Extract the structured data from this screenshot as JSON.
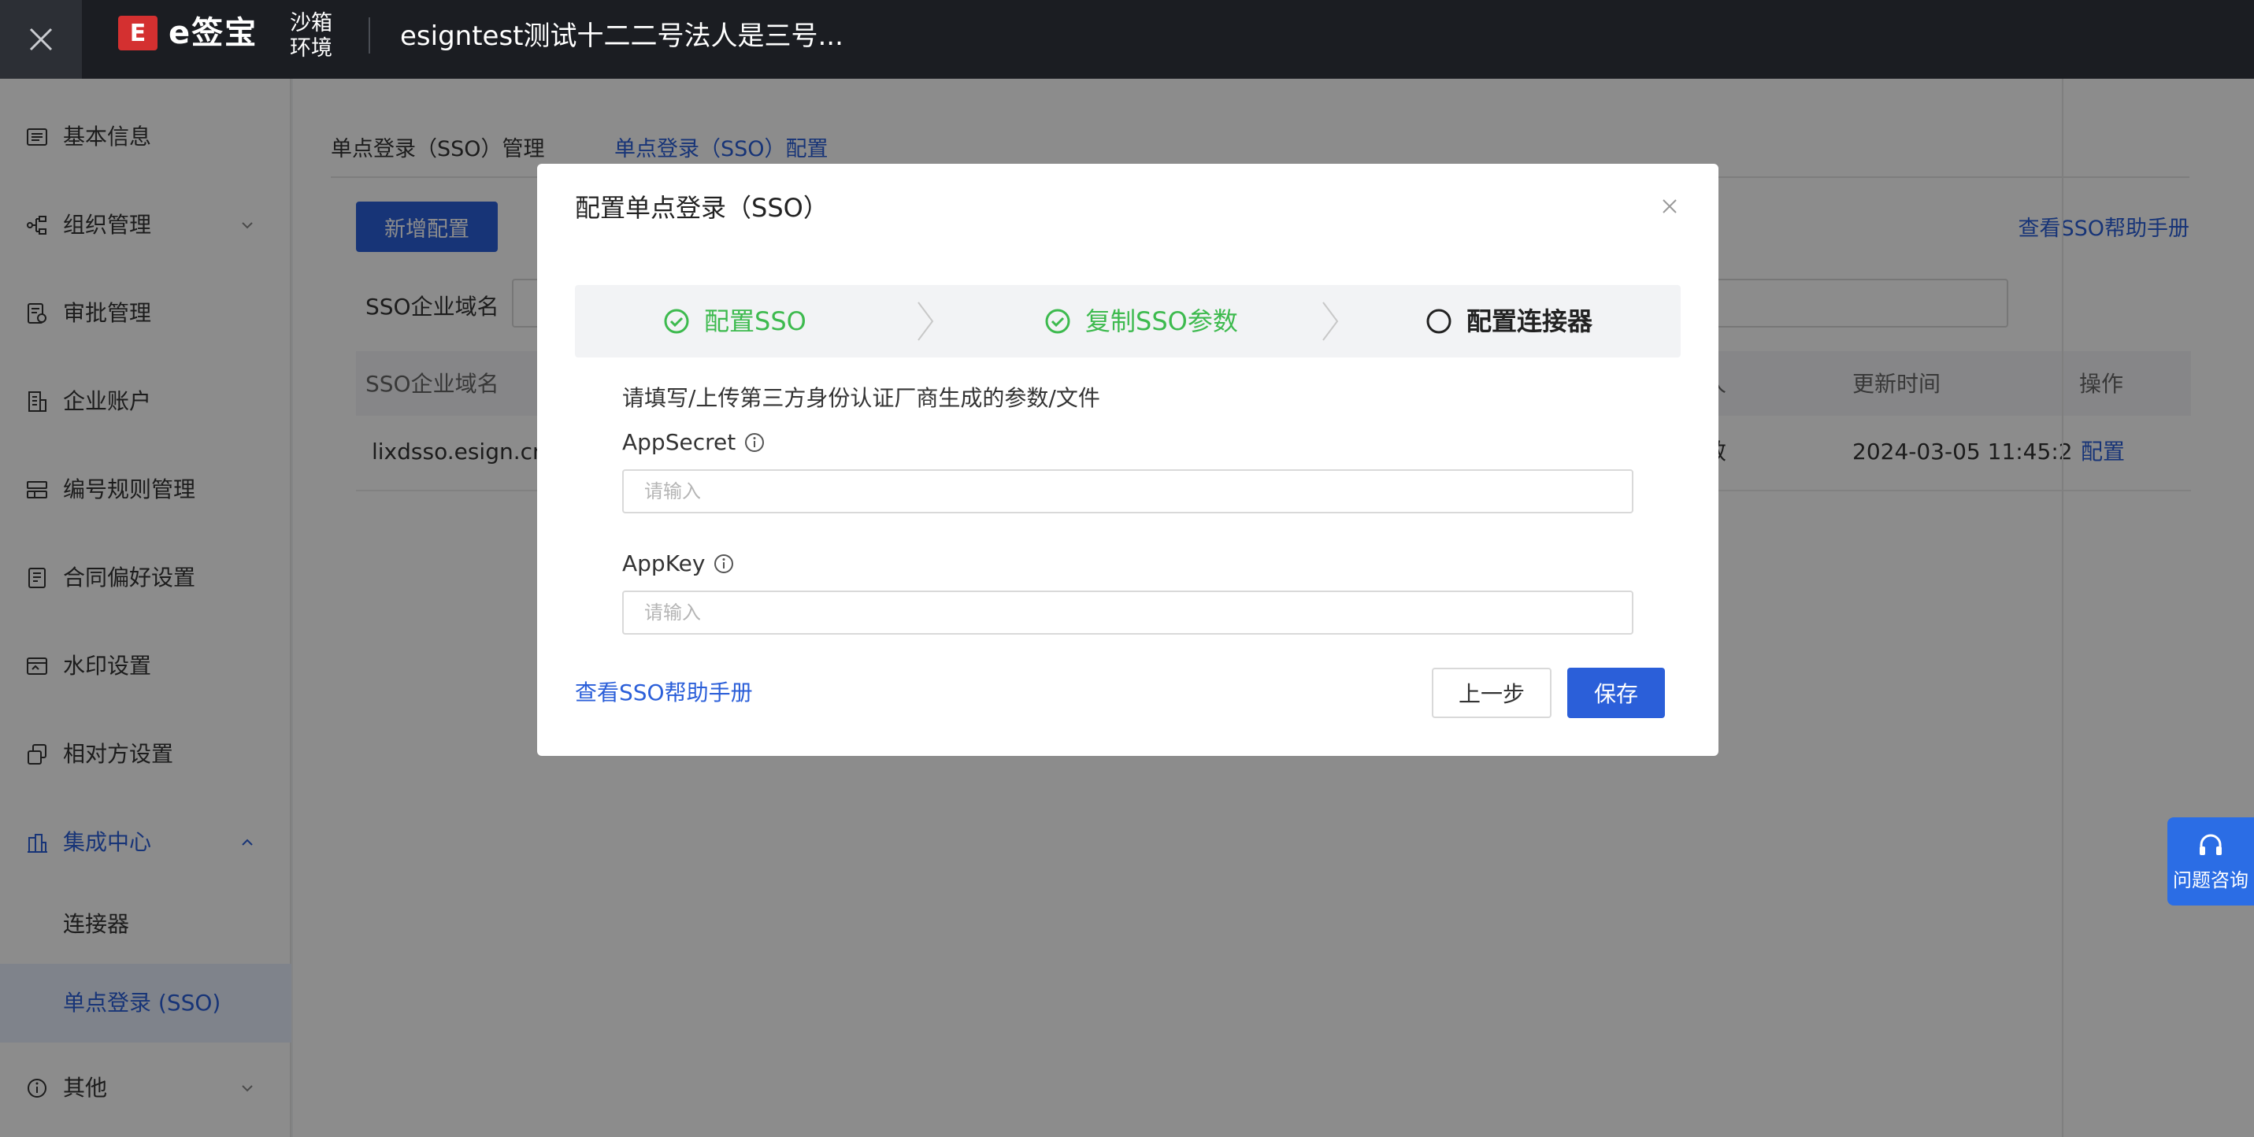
{
  "header": {
    "logo_mark": "E",
    "logo_text": "e签宝",
    "env_label": "沙箱环境",
    "org_title": "esigntest测试十二二号法人是三号..."
  },
  "sidebar": {
    "items": [
      {
        "label": "基本信息",
        "icon": "basic-info-icon"
      },
      {
        "label": "组织管理",
        "icon": "org-tree-icon"
      },
      {
        "label": "审批管理",
        "icon": "approval-icon"
      },
      {
        "label": "企业账户",
        "icon": "building-icon"
      },
      {
        "label": "编号规则管理",
        "icon": "numbering-icon"
      },
      {
        "label": "合同偏好设置",
        "icon": "contract-icon"
      },
      {
        "label": "水印设置",
        "icon": "watermark-icon"
      },
      {
        "label": "相对方设置",
        "icon": "counterparty-icon"
      },
      {
        "label": "集成中心",
        "icon": "integration-icon"
      },
      {
        "label": "其他",
        "icon": "info-circle-icon"
      }
    ],
    "sub_items": [
      {
        "label": "连接器"
      },
      {
        "label": "单点登录 (SSO)"
      }
    ]
  },
  "main": {
    "tabs": [
      {
        "label": "单点登录（SSO）管理"
      },
      {
        "label": "单点登录（SSO）配置"
      }
    ],
    "add_button": "新增配置",
    "help_link": "查看SSO帮助手册",
    "filter_label": "SSO企业域名",
    "table": {
      "headers": [
        "SSO企业域名",
        "人",
        "更新时间",
        "操作"
      ],
      "rows": [
        {
          "domain": "lixdsso.esign.cn",
          "status_fragment": "效",
          "updated": "2024-03-05 11:45:2",
          "action": "配置"
        }
      ]
    }
  },
  "modal": {
    "title": "配置单点登录（SSO）",
    "steps": [
      {
        "label": "配置SSO",
        "state": "done"
      },
      {
        "label": "复制SSO参数",
        "state": "done"
      },
      {
        "label": "配置连接器",
        "state": "current"
      }
    ],
    "instruction": "请填写/上传第三方身份认证厂商生成的参数/文件",
    "fields": [
      {
        "label": "AppSecret",
        "placeholder": "请输入",
        "value": ""
      },
      {
        "label": "AppKey",
        "placeholder": "请输入",
        "value": ""
      }
    ],
    "help_link": "查看SSO帮助手册",
    "prev_button": "上一步",
    "save_button": "保存"
  },
  "float_help": {
    "label": "问题咨询"
  },
  "colors": {
    "accent": "#2b5fd9",
    "success": "#3dba4e",
    "topbar": "#1b1d22",
    "overlay": "rgba(0,0,0,0.45)"
  }
}
